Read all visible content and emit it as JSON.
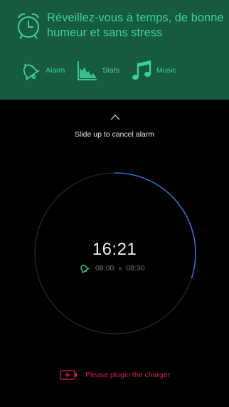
{
  "header": {
    "headline": "Réveillez-vous à temps, de bonne humeur et sans stress",
    "icons": {
      "headline": "alarm-clock-icon"
    },
    "features": [
      {
        "label": "Alarm",
        "icon": "bell-icon"
      },
      {
        "label": "Stats",
        "icon": "stats-chart-icon"
      },
      {
        "label": "Music",
        "icon": "music-note-icon"
      }
    ]
  },
  "main": {
    "slide_hint": "Slide up to cancel alarm",
    "time": "16:21",
    "window_start": "08:00",
    "window_separator": "»",
    "window_end": "08:30",
    "progress_fraction": 0.3,
    "charger_message": "Please plugin the charger"
  },
  "colors": {
    "banner": "#165a3f",
    "accent_green": "#3bd394",
    "ring_blue": "#2f6fd6",
    "warning_red": "#d0195b"
  }
}
